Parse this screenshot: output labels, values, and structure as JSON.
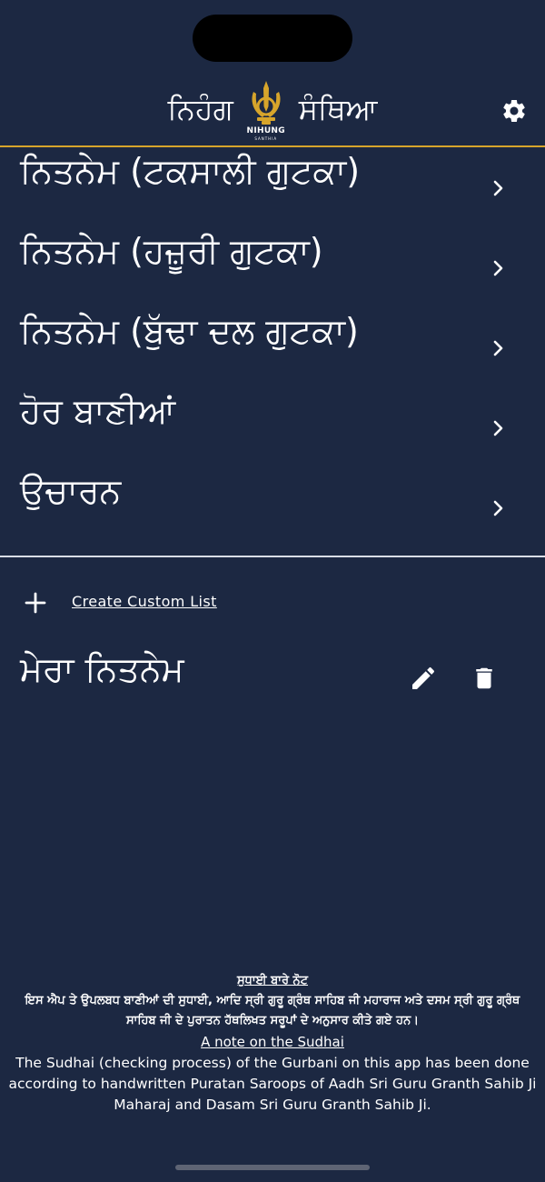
{
  "header": {
    "title_left": "ਨਿਹੰਗ",
    "title_right": "ਸੰਥਿਆ",
    "emblem_text": "NIHUNG",
    "emblem_subtext": "SANTHIA",
    "settings_icon": "gear-icon"
  },
  "colors": {
    "background": "#1c2842",
    "accent": "#d7a52b",
    "text": "#ffffff"
  },
  "menu": {
    "items": [
      {
        "label": "ਨਿਤਨੇਮ (ਟਕਸਾਲੀ ਗੁਟਕਾ)"
      },
      {
        "label": "ਨਿਤਨੇਮ (ਹਜ਼ੂਰੀ ਗੁਟਕਾ)"
      },
      {
        "label": "ਨਿਤਨੇਮ (ਬੁੱਢਾ ਦਲ ਗੁਟਕਾ)"
      },
      {
        "label": "ਹੋਰ ਬਾਣੀਆਂ"
      },
      {
        "label": "ਉਚਾਰਨ"
      }
    ]
  },
  "custom": {
    "create_label": "Create Custom List",
    "items": [
      {
        "label": "ਮੇਰਾ ਨਿਤਨੇਮ"
      }
    ]
  },
  "footer": {
    "heading": "ਸੁਧਾਈ ਬਾਰੇ ਨੋਟ",
    "punjabi_text": "ਇਸ ਐਪ ਤੇ ਉਪਲਬਧ ਬਾਣੀਆਂ ਦੀ ਸੁਧਾਈ, ਆਦਿ ਸ੍ਰੀ ਗੁਰੂ ਗ੍ਰੰਥ ਸਾਹਿਬ ਜੀ ਮਹਾਰਾਜ ਅਤੇ ਦਸਮ ਸ੍ਰੀ ਗੁਰੂ ਗ੍ਰੰਥ ਸਾਹਿਬ ਜੀ ਦੇ ਪੁਰਾਤਨ ਹੱਥਲਿਖਤ ਸਰੂਪਾਂ ਦੇ ਅਨੁਸਾਰ ਕੀਤੇ ਗਏ ਹਨ।",
    "link_label": "A note on the Sudhai",
    "english_text": "The Sudhai (checking process) of the Gurbani on this app has been done according to handwritten Puratan Saroops of Aadh Sri Guru Granth Sahib Ji Maharaj and Dasam Sri Guru Granth Sahib Ji."
  }
}
